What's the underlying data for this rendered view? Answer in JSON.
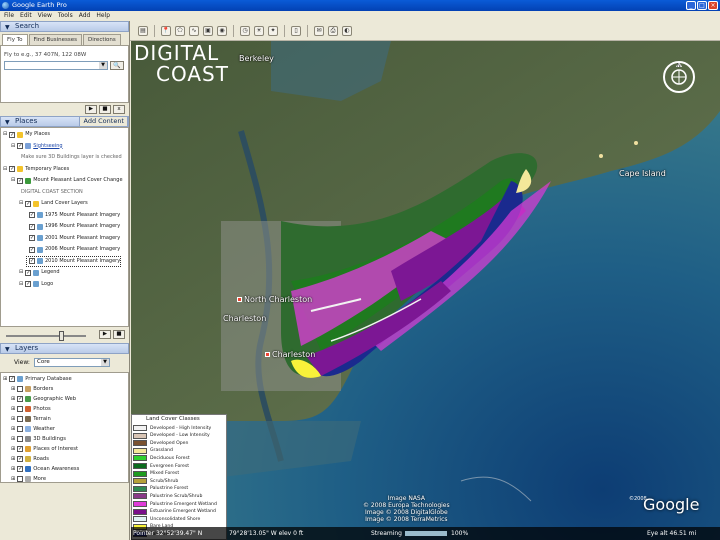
{
  "window": {
    "title": "Google Earth Pro",
    "buttons": [
      "_",
      "□",
      "×"
    ]
  },
  "menu": [
    "File",
    "Edit",
    "View",
    "Tools",
    "Add",
    "Help"
  ],
  "toolbar": {
    "icons": [
      "sidebar-toggle-icon",
      "placemark-icon",
      "polygon-icon",
      "path-icon",
      "overlay-icon",
      "tour-icon",
      "historical-imagery-icon",
      "sun-icon",
      "sky-icon",
      "ruler-icon",
      "email-icon",
      "print-icon",
      "view-in-maps-icon"
    ]
  },
  "search": {
    "header": "Search",
    "tabs": [
      "Fly To",
      "Find Businesses",
      "Directions"
    ],
    "hint": "Fly to e.g., 37 407N, 122 08W",
    "placeholder": "",
    "go": "🔍",
    "controls": [
      "▶",
      "■",
      "x"
    ]
  },
  "places": {
    "header": "Places",
    "add_content": "Add Content",
    "items": [
      {
        "label": "My Places",
        "checked": true,
        "indent": 1,
        "color": "#f3c32b"
      },
      {
        "label": "Sightseeing",
        "checked": true,
        "indent": 2,
        "color": "#7aa0d8",
        "link": true
      },
      {
        "label": "Make sure 3D Buildings layer is checked",
        "checked": null,
        "indent": 3,
        "color": null,
        "dim": true
      },
      {
        "label": "Temporary Places",
        "checked": true,
        "indent": 1,
        "color": "#f3c32b"
      },
      {
        "label": "Mount Pleasant Land Cover Change",
        "checked": true,
        "indent": 2,
        "color": "#3c9a3c"
      },
      {
        "label": "DIGITAL COAST SECTION",
        "checked": null,
        "indent": 3,
        "color": null,
        "dim": true
      },
      {
        "label": "Land Cover Layers",
        "checked": true,
        "indent": 3,
        "color": "#f3c32b"
      },
      {
        "label": "1975 Mount Pleasant Imagery",
        "checked": true,
        "indent": 4,
        "color": "#6aa0d0"
      },
      {
        "label": "1996 Mount Pleasant Imagery",
        "checked": true,
        "indent": 4,
        "color": "#6aa0d0"
      },
      {
        "label": "2001 Mount Pleasant Imagery",
        "checked": true,
        "indent": 4,
        "color": "#6aa0d0"
      },
      {
        "label": "2006 Mount Pleasant Imagery",
        "checked": true,
        "indent": 4,
        "color": "#6aa0d0"
      },
      {
        "label": "2010 Mount Pleasant Imagery",
        "checked": true,
        "indent": 4,
        "color": "#6aa0d0",
        "highlight": true
      },
      {
        "label": "Legend",
        "checked": true,
        "indent": 3,
        "color": "#6aa0d0"
      },
      {
        "label": "Logo",
        "checked": true,
        "indent": 3,
        "color": "#6aa0d0"
      }
    ],
    "slider_value": 0.7,
    "controls": [
      "▶",
      "■"
    ]
  },
  "layers": {
    "header": "Layers",
    "view_label": "View:",
    "view_value": "Core",
    "items": [
      {
        "label": "Primary Database",
        "checked": true,
        "color": "#6aa0d0"
      },
      {
        "label": "Borders",
        "checked": false,
        "color": "#c8a060"
      },
      {
        "label": "Geographic Web",
        "checked": true,
        "color": "#4a9a4a"
      },
      {
        "label": "Photos",
        "checked": false,
        "color": "#d06030"
      },
      {
        "label": "Terrain",
        "checked": false,
        "color": "#7a6a50"
      },
      {
        "label": "Weather",
        "checked": false,
        "color": "#8ab0e0"
      },
      {
        "label": "3D Buildings",
        "checked": false,
        "color": "#888888"
      },
      {
        "label": "Places of Interest",
        "checked": true,
        "color": "#e0a030"
      },
      {
        "label": "Roads",
        "checked": true,
        "color": "#d0b040"
      },
      {
        "label": "Ocean Awareness",
        "checked": true,
        "color": "#3070c0"
      },
      {
        "label": "More",
        "checked": false,
        "color": "#aaaaaa"
      }
    ]
  },
  "map": {
    "logo_line1": "DIGITAL",
    "logo_line2": "COAST",
    "labels": [
      {
        "text": "Berkeley",
        "pin": false
      },
      {
        "text": "Cape Island",
        "pin": false
      },
      {
        "text": "North Charleston",
        "pin": true
      },
      {
        "text": "Charleston",
        "pin": false
      },
      {
        "text": "Charleston",
        "pin": true
      }
    ],
    "credits": [
      "Image NASA",
      "© 2008 Europa Technologies",
      "Image © 2008 DigitalGlobe",
      "Image © 2008 TerraMetrics"
    ],
    "google": "Google",
    "pointer": "Pointer  32°52'39.47\" N",
    "coords": "79°28'13.05\" W  elev  0 ft",
    "streaming_label": "Streaming",
    "streaming_pct": "100%",
    "streaming_value": 1.0,
    "eye_alt": "Eye alt   46.51 mi"
  },
  "legend": {
    "title": "Land Cover Classes",
    "items": [
      {
        "label": "Developed - High Intensity",
        "color": "#f2f2f2"
      },
      {
        "label": "Developed - Low Intensity",
        "color": "#d9c5b5"
      },
      {
        "label": "Developed Open",
        "color": "#7a5230"
      },
      {
        "label": "Grassland",
        "color": "#f4e89a"
      },
      {
        "label": "Deciduous Forest",
        "color": "#2fd02f"
      },
      {
        "label": "Evergreen Forest",
        "color": "#0b6b1d"
      },
      {
        "label": "Mixed Forest",
        "color": "#1f9b1f"
      },
      {
        "label": "Scrub/Shrub",
        "color": "#b5a13a"
      },
      {
        "label": "Palustrine Forest",
        "color": "#2e8a52"
      },
      {
        "label": "Palustrine Scrub/Shrub",
        "color": "#8a3a88"
      },
      {
        "label": "Palustrine Emergent Wetland",
        "color": "#e03bd8"
      },
      {
        "label": "Estuarine Emergent Wetland",
        "color": "#7a0f8a"
      },
      {
        "label": "Unconsolidated Shore",
        "color": "#e0f4f4"
      },
      {
        "label": "Bare Land",
        "color": "#f8f23a"
      },
      {
        "label": "Palustrine",
        "color": "#1a2a8e"
      }
    ]
  }
}
